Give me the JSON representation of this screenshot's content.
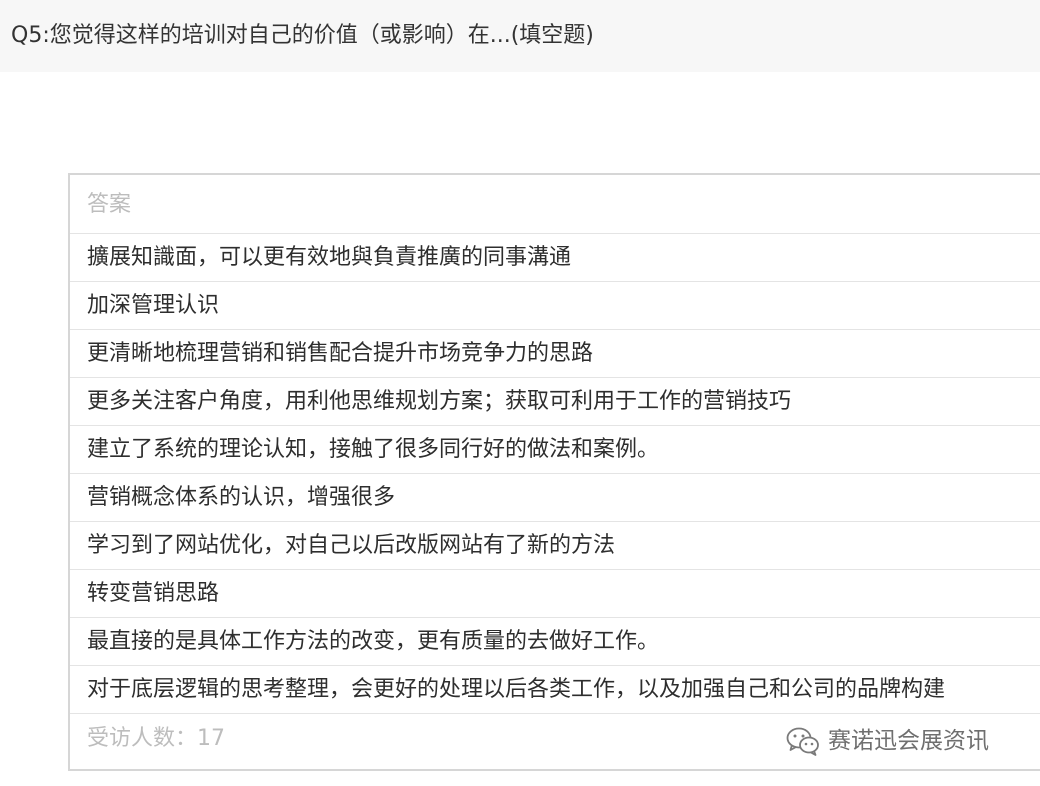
{
  "question": {
    "title": "Q5:您觉得这样的培训对自己的价值（或影响）在...(填空题)"
  },
  "table": {
    "header": "答案",
    "rows": [
      "擴展知識面，可以更有效地與負責推廣的同事溝通",
      "加深管理认识",
      "更清晰地梳理营销和销售配合提升市场竞争力的思路",
      "更多关注客户角度，用利他思维规划方案；获取可利用于工作的营销技巧",
      "建立了系统的理论认知，接触了很多同行好的做法和案例。",
      "营销概念体系的认识，增强很多",
      "学习到了网站优化，对自己以后改版网站有了新的方法",
      "转变营销思路",
      "最直接的是具体工作方法的改变，更有质量的去做好工作。",
      "对于底层逻辑的思考整理，会更好的处理以后各类工作，以及加强自己和公司的品牌构建"
    ],
    "footer": "受访人数：17"
  },
  "watermark": {
    "icon": "wechat-icon",
    "text": "赛诺迅会展资讯"
  }
}
